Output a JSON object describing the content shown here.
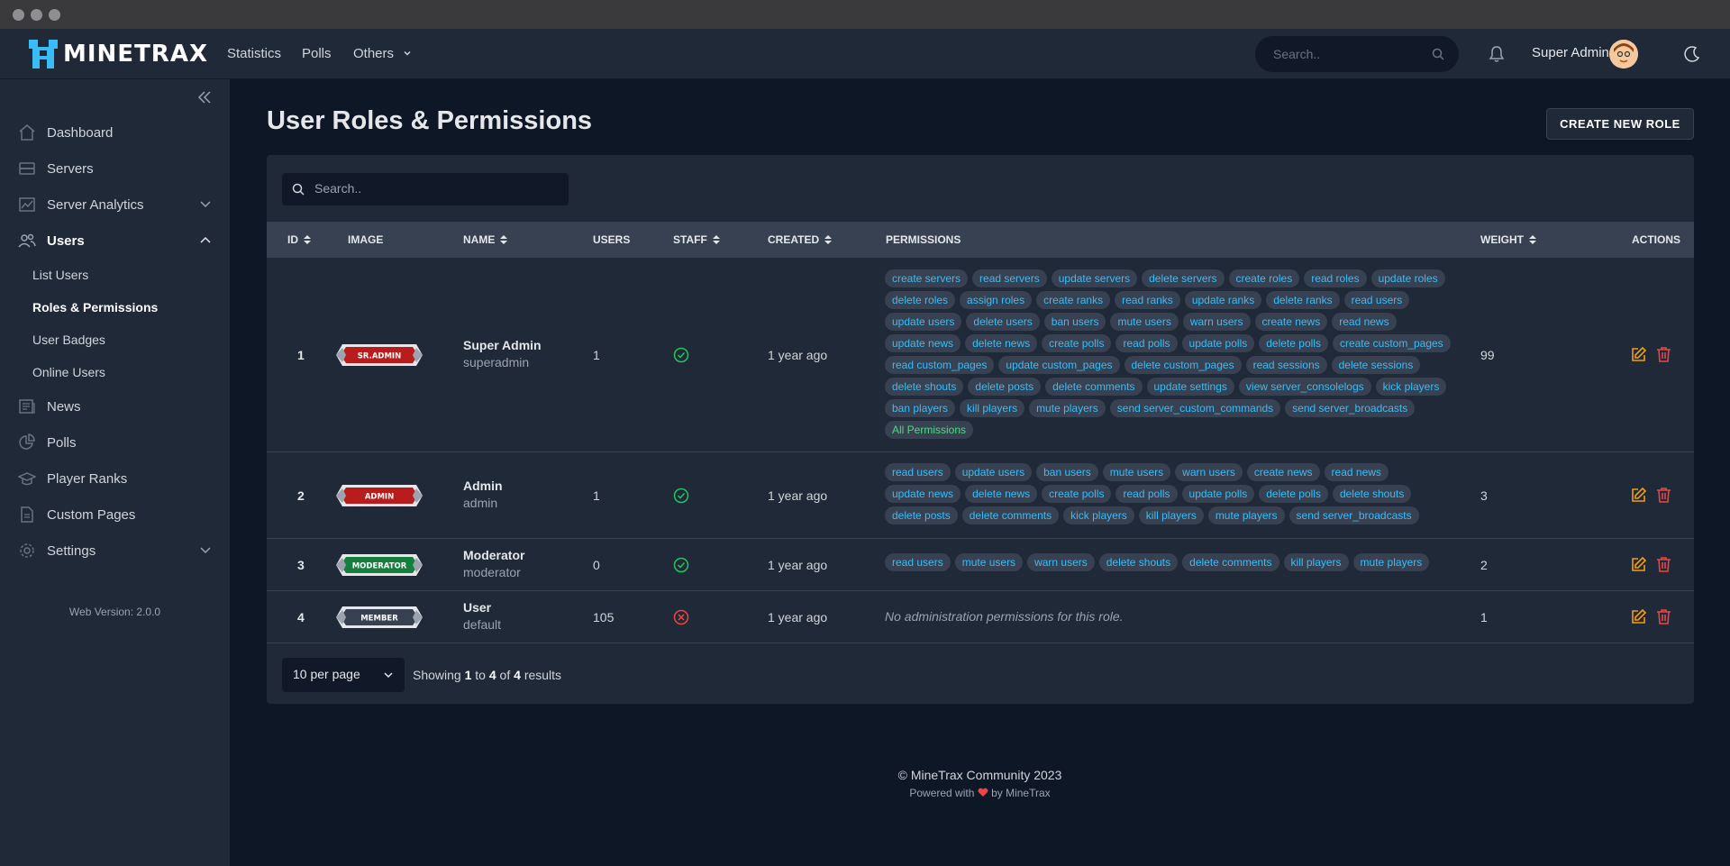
{
  "app": {
    "brand": "MINETRAX",
    "nav": [
      "Statistics",
      "Polls",
      "Others"
    ],
    "search_placeholder": "Search..",
    "user_name": "Super Admin"
  },
  "sidebar": {
    "items": [
      {
        "label": "Dashboard",
        "icon": "home-icon"
      },
      {
        "label": "Servers",
        "icon": "server-icon"
      },
      {
        "label": "Server Analytics",
        "icon": "chart-icon"
      },
      {
        "label": "Users",
        "icon": "users-icon"
      },
      {
        "label": "News",
        "icon": "newspaper-icon"
      },
      {
        "label": "Polls",
        "icon": "pie-icon"
      },
      {
        "label": "Player Ranks",
        "icon": "graduation-icon"
      },
      {
        "label": "Custom Pages",
        "icon": "document-icon"
      },
      {
        "label": "Settings",
        "icon": "gear-icon"
      }
    ],
    "user_sub": [
      "List Users",
      "Roles & Permissions",
      "User Badges",
      "Online Users"
    ],
    "version": "Web Version: 2.0.0"
  },
  "page": {
    "title": "User Roles & Permissions",
    "create_button": "CREATE NEW ROLE",
    "search_placeholder": "Search.."
  },
  "table": {
    "headers": [
      "ID",
      "IMAGE",
      "NAME",
      "USERS",
      "STAFF",
      "CREATED",
      "PERMISSIONS",
      "WEIGHT",
      "ACTIONS"
    ],
    "rows": [
      {
        "id": "1",
        "badge": "SR.ADMIN",
        "badge_color": "#b91c1c",
        "name": "Super Admin",
        "slug": "superadmin",
        "users": "1",
        "staff": true,
        "created": "1 year ago",
        "weight": "99",
        "permissions": [
          "create servers",
          "read servers",
          "update servers",
          "delete servers",
          "create roles",
          "read roles",
          "update roles",
          "delete roles",
          "assign roles",
          "create ranks",
          "read ranks",
          "update ranks",
          "delete ranks",
          "read users",
          "update users",
          "delete users",
          "ban users",
          "mute users",
          "warn users",
          "create news",
          "read news",
          "update news",
          "delete news",
          "create polls",
          "read polls",
          "update polls",
          "delete polls",
          "create custom_pages",
          "read custom_pages",
          "update custom_pages",
          "delete custom_pages",
          "read sessions",
          "delete sessions",
          "delete shouts",
          "delete posts",
          "delete comments",
          "update settings",
          "view server_consolelogs",
          "kick players",
          "ban players",
          "kill players",
          "mute players",
          "send server_custom_commands",
          "send server_broadcasts"
        ],
        "all_label": "All Permissions"
      },
      {
        "id": "2",
        "badge": "ADMIN",
        "badge_color": "#b91c1c",
        "name": "Admin",
        "slug": "admin",
        "users": "1",
        "staff": true,
        "created": "1 year ago",
        "weight": "3",
        "permissions": [
          "read users",
          "update users",
          "ban users",
          "mute users",
          "warn users",
          "create news",
          "read news",
          "update news",
          "delete news",
          "create polls",
          "read polls",
          "update polls",
          "delete polls",
          "delete shouts",
          "delete posts",
          "delete comments",
          "kick players",
          "kill players",
          "mute players",
          "send server_broadcasts"
        ]
      },
      {
        "id": "3",
        "badge": "MODERATOR",
        "badge_color": "#15803d",
        "name": "Moderator",
        "slug": "moderator",
        "users": "0",
        "staff": true,
        "created": "1 year ago",
        "weight": "2",
        "permissions": [
          "read users",
          "mute users",
          "warn users",
          "delete shouts",
          "delete comments",
          "kill players",
          "mute players"
        ]
      },
      {
        "id": "4",
        "badge": "MEMBER",
        "badge_color": "#374151",
        "name": "User",
        "slug": "default",
        "users": "105",
        "staff": false,
        "created": "1 year ago",
        "weight": "1",
        "no_permissions": "No administration permissions for this role."
      }
    ]
  },
  "pager": {
    "per_page": "10 per page",
    "showing_prefix": "Showing",
    "from": "1",
    "to_word": "to",
    "to": "4",
    "of_word": "of",
    "total": "4",
    "suffix": "results"
  },
  "footer": {
    "copyright": "© MineTrax Community 2023",
    "powered_prefix": "Powered with",
    "powered_suffix": "by MineTrax"
  },
  "colors": {
    "accent": "#38bdf8",
    "success": "#22c55e",
    "danger": "#ef4444",
    "edit": "#f59e0b"
  }
}
